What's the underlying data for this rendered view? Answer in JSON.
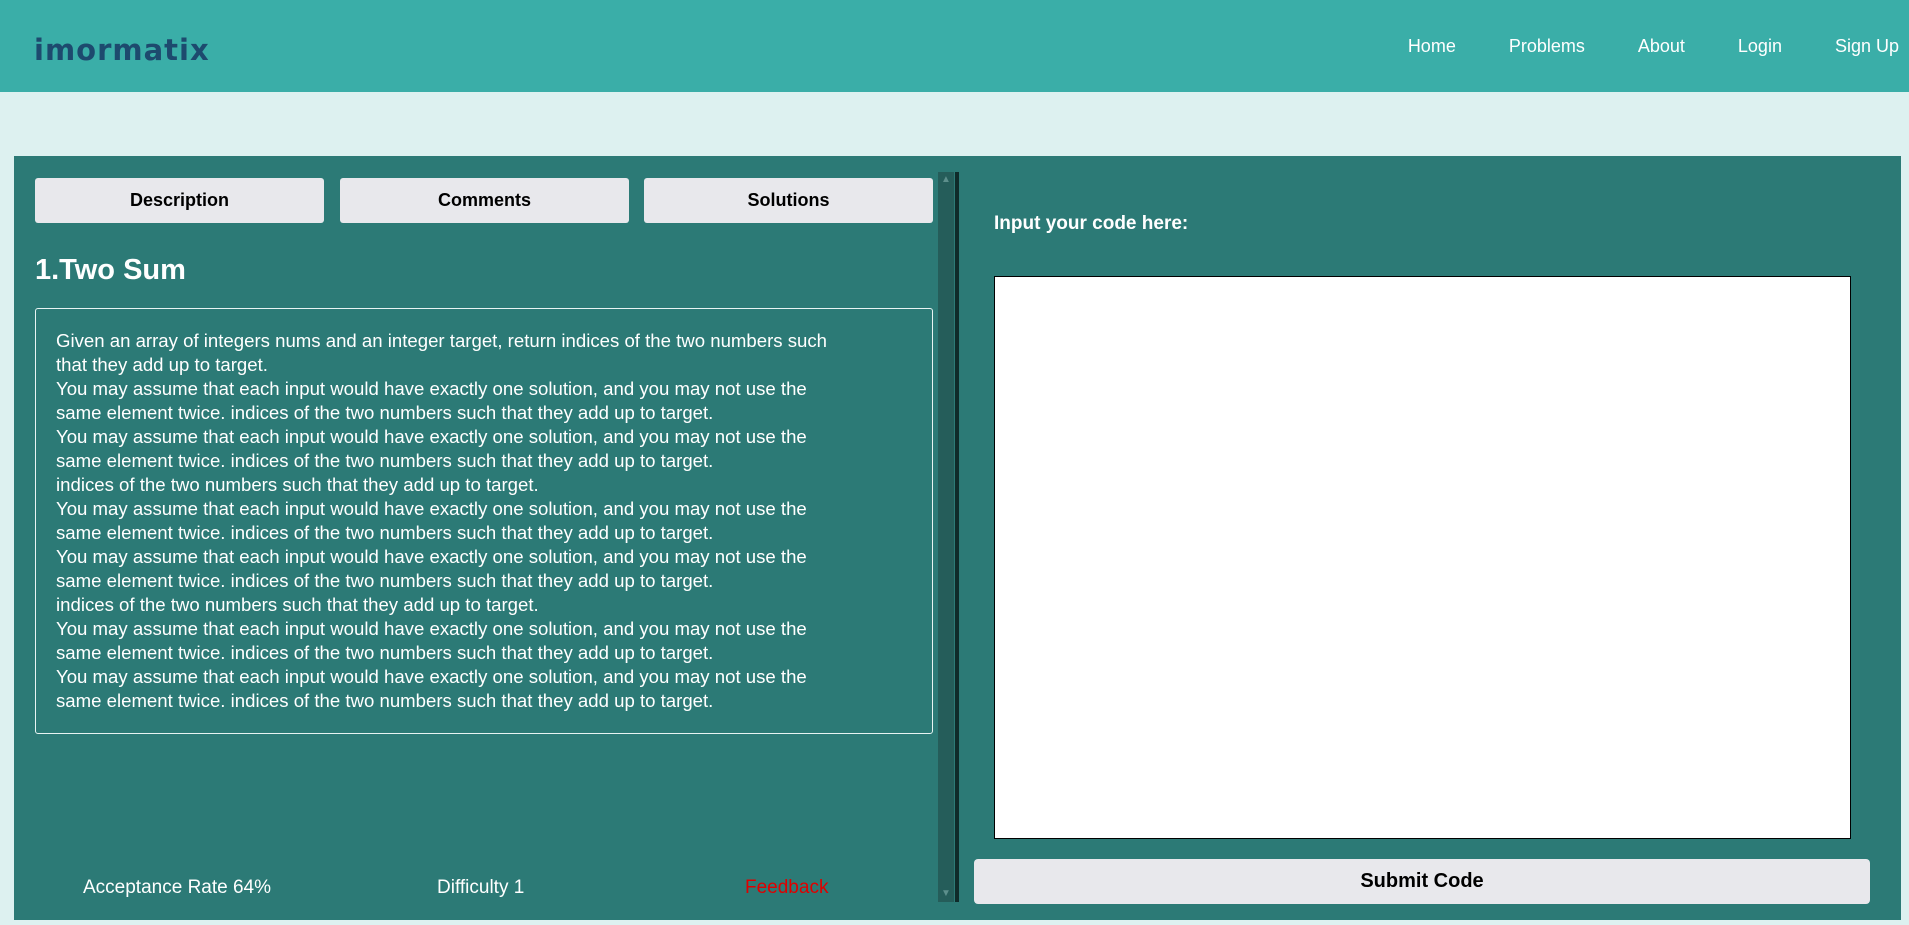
{
  "header": {
    "logo_text": "imormatix",
    "nav": [
      {
        "label": "Home"
      },
      {
        "label": "Problems"
      },
      {
        "label": "About"
      },
      {
        "label": "Login"
      },
      {
        "label": "Sign Up"
      }
    ]
  },
  "tabs": [
    {
      "label": "Description"
    },
    {
      "label": "Comments"
    },
    {
      "label": "Solutions"
    }
  ],
  "problem": {
    "title": "1.Two Sum",
    "description_lines": [
      "Given an array of integers nums and an integer target, return indices of the two numbers such",
      "that they add up to target.",
      "You may assume that each input would have exactly one solution, and you may not use the",
      "same element twice. indices of the two numbers such that they add up to target.",
      "You may assume that each input would have exactly one solution, and you may not use the",
      "same element twice. indices of the two numbers such that they add up to target.",
      "indices of the two numbers such that they add up to target.",
      "You may assume that each input would have exactly one solution, and you may not use the",
      "same element twice. indices of the two numbers such that they add up to target.",
      "You may assume that each input would have exactly one solution, and you may not use the",
      "same element twice. indices of the two numbers such that they add up to target.",
      "indices of the two numbers such that they add up to target.",
      "You may assume that each input would have exactly one solution, and you may not use the",
      "same element twice. indices of the two numbers such that they add up to target.",
      "You may assume that each input would have exactly one solution, and you may not use the",
      "same element twice. indices of the two numbers such that they add up to target."
    ]
  },
  "stats": {
    "acceptance_rate": "Acceptance Rate 64%",
    "difficulty": "Difficulty 1",
    "feedback_label": "Feedback"
  },
  "editor": {
    "label": "Input your code here:",
    "value": "",
    "submit_label": "Submit Code"
  },
  "colors": {
    "header_bg": "#3aaea8",
    "page_bg": "#ddf1f0",
    "panel_bg": "#2c7a76",
    "button_bg": "#e8e8ec",
    "feedback": "#e00000",
    "logo": "#1d4a6e"
  },
  "icons": {
    "scroll_up": "scroll-up-arrow-icon",
    "scroll_down": "scroll-down-arrow-icon"
  }
}
